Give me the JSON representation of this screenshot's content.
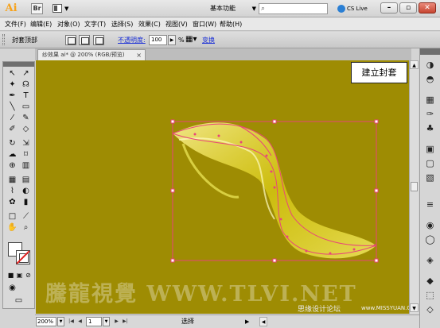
{
  "app": {
    "logo": "Ai",
    "bridge": "Br",
    "workspace": "基本功能",
    "search_placeholder": "",
    "cs_live": "CS Live",
    "window_min": "–",
    "window_restore": "▫",
    "window_close": "✕"
  },
  "menu": {
    "items": [
      {
        "label": "文件(F)"
      },
      {
        "label": "编辑(E)"
      },
      {
        "label": "对象(O)"
      },
      {
        "label": "文字(T)"
      },
      {
        "label": "选择(S)"
      },
      {
        "label": "效果(C)"
      },
      {
        "label": "视图(V)"
      },
      {
        "label": "窗口(W)"
      },
      {
        "label": "帮助(H)"
      }
    ]
  },
  "control": {
    "label": "封套顶部",
    "opacity_label": "不透明度:",
    "opacity_value": "100",
    "opacity_unit": "%",
    "transform_link": "变换"
  },
  "document": {
    "tab_title": "纱效果 ai* @ 200% (RGB/预览)",
    "tab_close": "×"
  },
  "canvas": {
    "tooltip": "建立封套",
    "background_color": "#9e8c03",
    "path_color": "#e8457a",
    "fill_color": "#f2e419",
    "watermark": "騰龍視覺 WWW.TLVI.NET",
    "site_name": "思缘设计论坛",
    "site_url": "www.MISSYUAN.COM"
  },
  "status": {
    "zoom": "200%",
    "page": "1",
    "tool_label": "选择"
  }
}
